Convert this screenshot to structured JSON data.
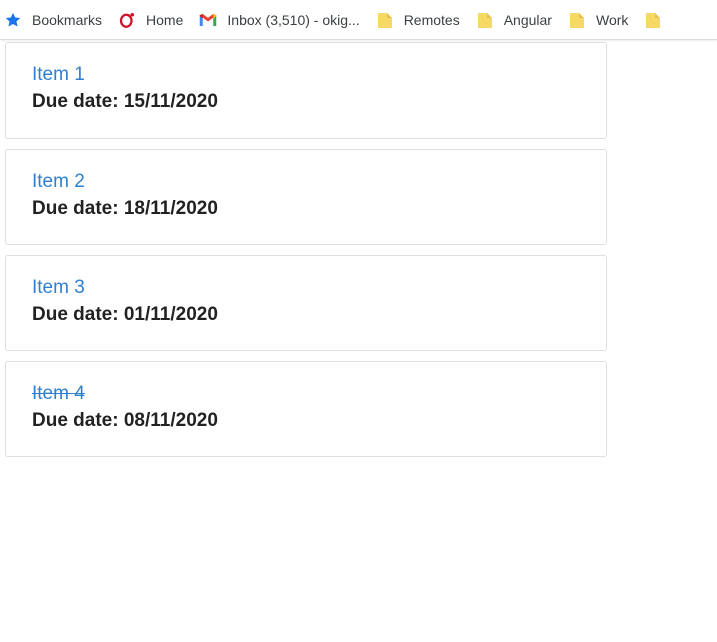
{
  "bookmarks_bar": {
    "items": [
      {
        "label": "Bookmarks",
        "icon": "star-icon"
      },
      {
        "label": "Home",
        "icon": "opera-icon"
      },
      {
        "label": "Inbox (3,510) - okig...",
        "icon": "gmail-icon"
      },
      {
        "label": "Remotes",
        "icon": "folder-icon"
      },
      {
        "label": "Angular",
        "icon": "folder-icon"
      },
      {
        "label": "Work",
        "icon": "folder-icon"
      }
    ]
  },
  "colors": {
    "link": "#2f80d0",
    "text": "#222222",
    "card_border": "#dfdfdf",
    "folder": "#f6d964"
  },
  "todo": {
    "items": [
      {
        "title": "Item 1",
        "due": "Due date: 15/11/2020",
        "completed": false
      },
      {
        "title": "Item 2",
        "due": "Due date: 18/11/2020",
        "completed": false
      },
      {
        "title": "Item 3",
        "due": "Due date: 01/11/2020",
        "completed": false
      },
      {
        "title": "Item 4",
        "due": "Due date: 08/11/2020",
        "completed": true
      }
    ]
  }
}
